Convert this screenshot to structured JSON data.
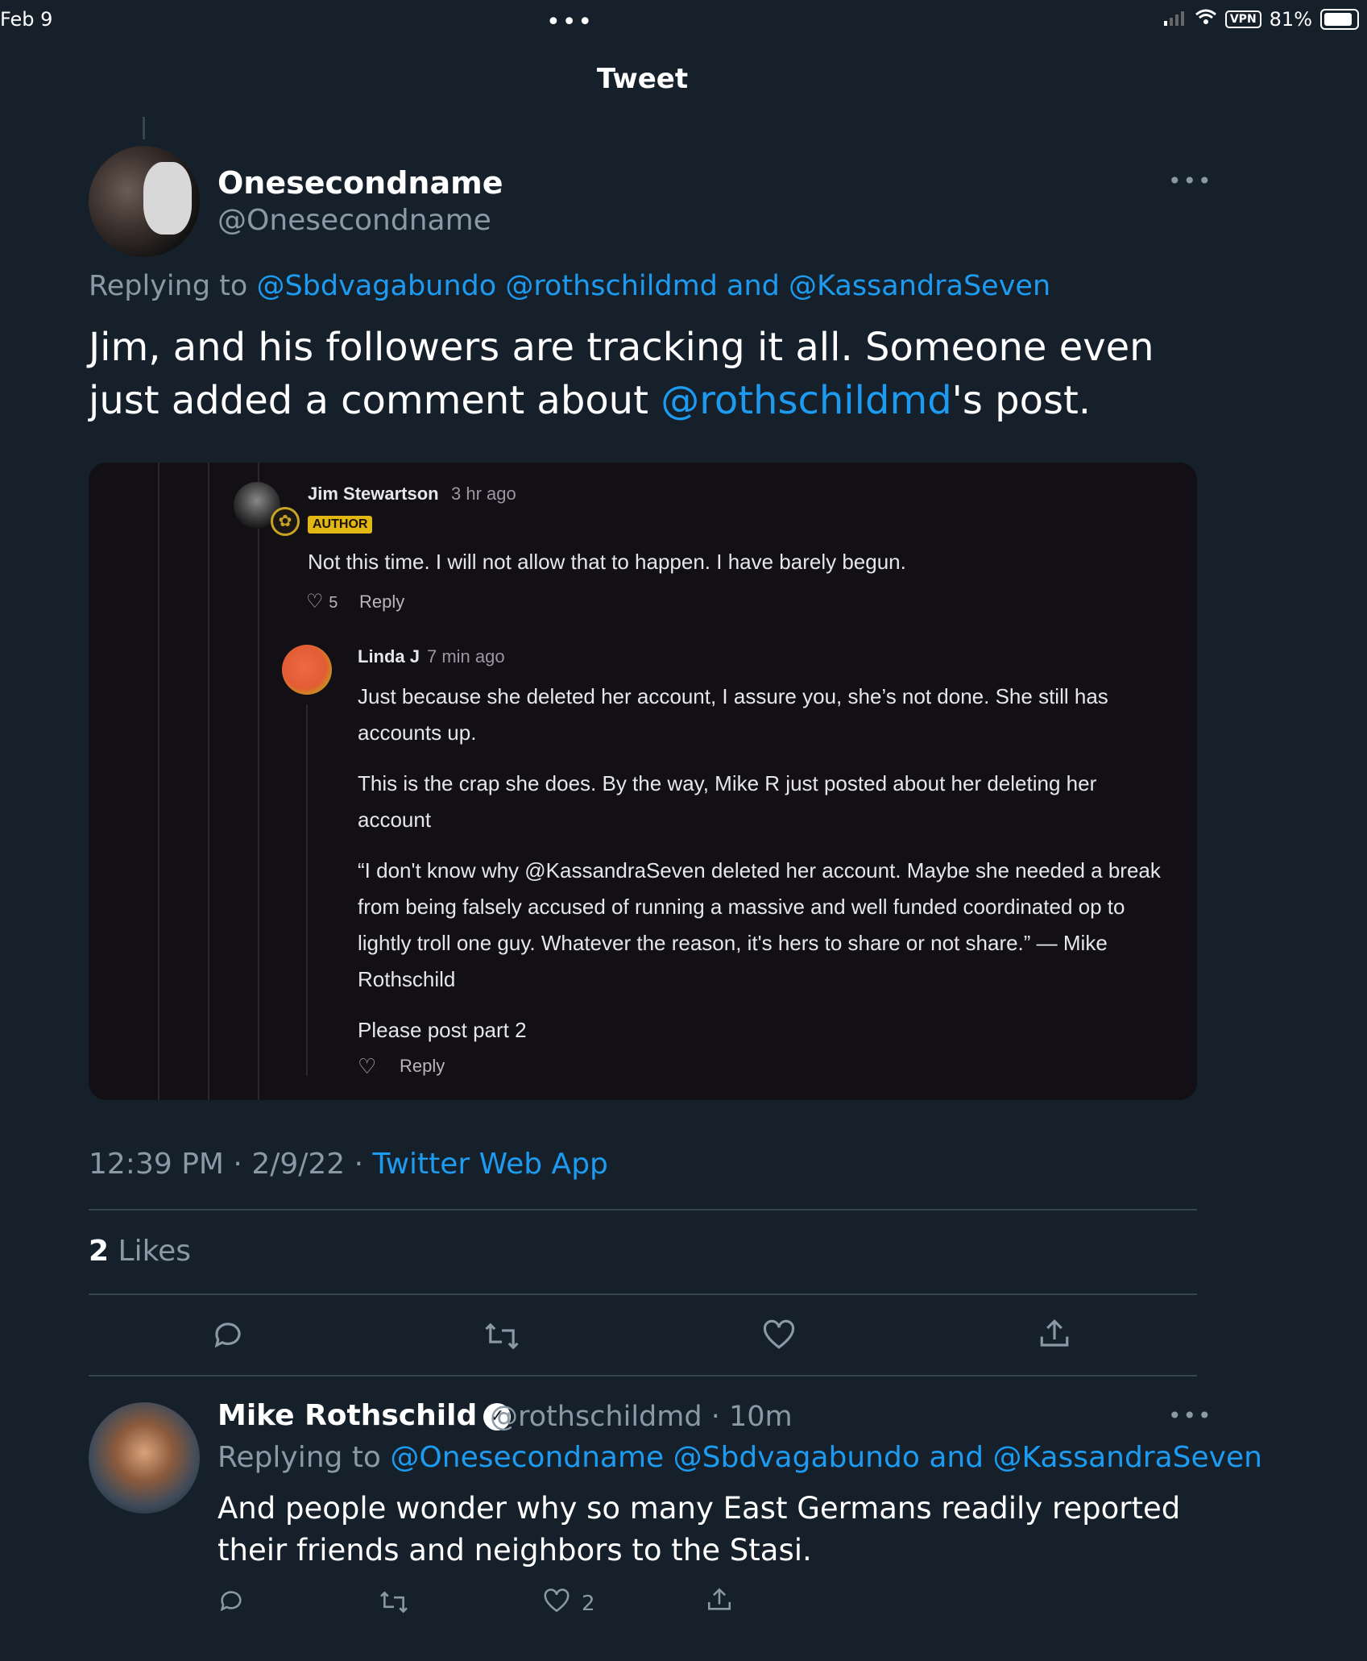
{
  "status_bar": {
    "date": "Feb 9",
    "dots": "•••",
    "vpn": "VPN",
    "battery": "81%"
  },
  "header": {
    "title": "Tweet"
  },
  "main_tweet": {
    "name": "Onesecondname",
    "handle": "@Onesecondname",
    "replying_prefix": "Replying to",
    "replying_to": [
      "@Sbdvagabundo",
      "@rothschildmd",
      "@KassandraSeven"
    ],
    "replying_and": "and",
    "text_part1": "Jim, and his followers are tracking it all. Someone even just added a comment about ",
    "text_mention": "@rothschildmd",
    "text_part2": "'s post.",
    "time": "12:39 PM",
    "date": "2/9/22",
    "source": "Twitter Web App",
    "likes_count": "2",
    "likes_label": "Likes"
  },
  "embedded": {
    "comment1": {
      "name": "Jim Stewartson",
      "time": "3 hr ago",
      "badge": "AUTHOR",
      "text": "Not this time. I will not allow that to happen. I have barely begun.",
      "likes": "5",
      "reply": "Reply"
    },
    "comment2": {
      "name": "Linda J",
      "time": "7 min ago",
      "paragraphs": [
        "Just because she deleted her account, I assure you, she’s not done. She still has accounts up.",
        "This is the crap she does. By the way, Mike R just posted about her deleting her account",
        "“I don't know why @KassandraSeven deleted her account. Maybe she needed a break from being falsely accused of running a massive and well funded coordinated op to lightly troll one guy. Whatever the reason, it's hers to share or not share.” — Mike Rothschild",
        "Please post part 2"
      ],
      "reply": "Reply"
    }
  },
  "reply_tweet": {
    "name": "Mike Rothschild",
    "handle": "@rothschildmd",
    "age": "10m",
    "replying_prefix": "Replying to",
    "replying_to": [
      "@Onesecondname",
      "@Sbdvagabundo",
      "@KassandraSeven"
    ],
    "replying_and": "and",
    "text": "And people wonder why so many East Germans readily reported their friends and neighbors to the Stasi.",
    "like_count": "2"
  },
  "icons": [
    "reply-icon",
    "retweet-icon",
    "like-icon",
    "share-icon",
    "more-icon",
    "verified-icon"
  ],
  "colors": {
    "background": "#15202b",
    "link": "#1d9bf0",
    "muted": "#8b98a5",
    "author_badge": "#e2b714"
  }
}
